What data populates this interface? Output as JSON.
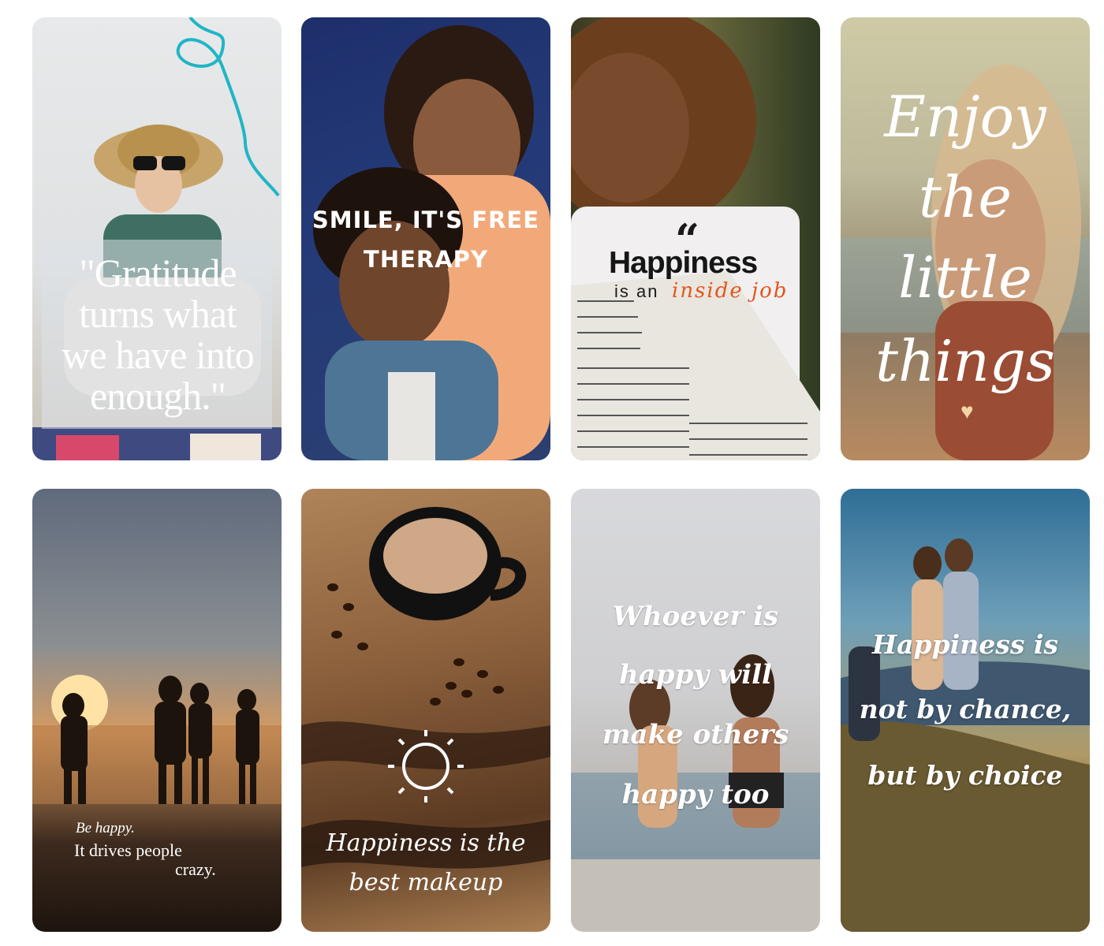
{
  "cards": [
    {
      "id": "gratitude",
      "quote_lines": [
        "\"Gratitude",
        "turns what",
        "we have into",
        "enough.\""
      ],
      "accent_color": "#1fb5c6"
    },
    {
      "id": "smile",
      "quote_lines": [
        "SMILE, IT'S FREE",
        "THERAPY"
      ]
    },
    {
      "id": "happiness-inside-job",
      "quote_mark": "“",
      "title": "Happiness",
      "sub": "is an",
      "accent": "inside job",
      "accent_color": "#e0571e"
    },
    {
      "id": "enjoy-little-things",
      "quote_lines": [
        "Enjoy",
        "the",
        "little",
        "things"
      ],
      "heart": "♥"
    },
    {
      "id": "be-happy",
      "small": "Be happy.",
      "quote_lines": [
        "It drives people",
        "crazy."
      ]
    },
    {
      "id": "best-makeup",
      "quote_lines": [
        "Happiness is the",
        "best makeup"
      ],
      "icon": "sun-icon"
    },
    {
      "id": "make-others-happy",
      "quote_lines": [
        "Whoever is",
        "happy will",
        "make others",
        "happy too"
      ]
    },
    {
      "id": "by-choice",
      "quote_lines": [
        "Happiness is",
        "not by chance,",
        "but by choice"
      ]
    }
  ]
}
